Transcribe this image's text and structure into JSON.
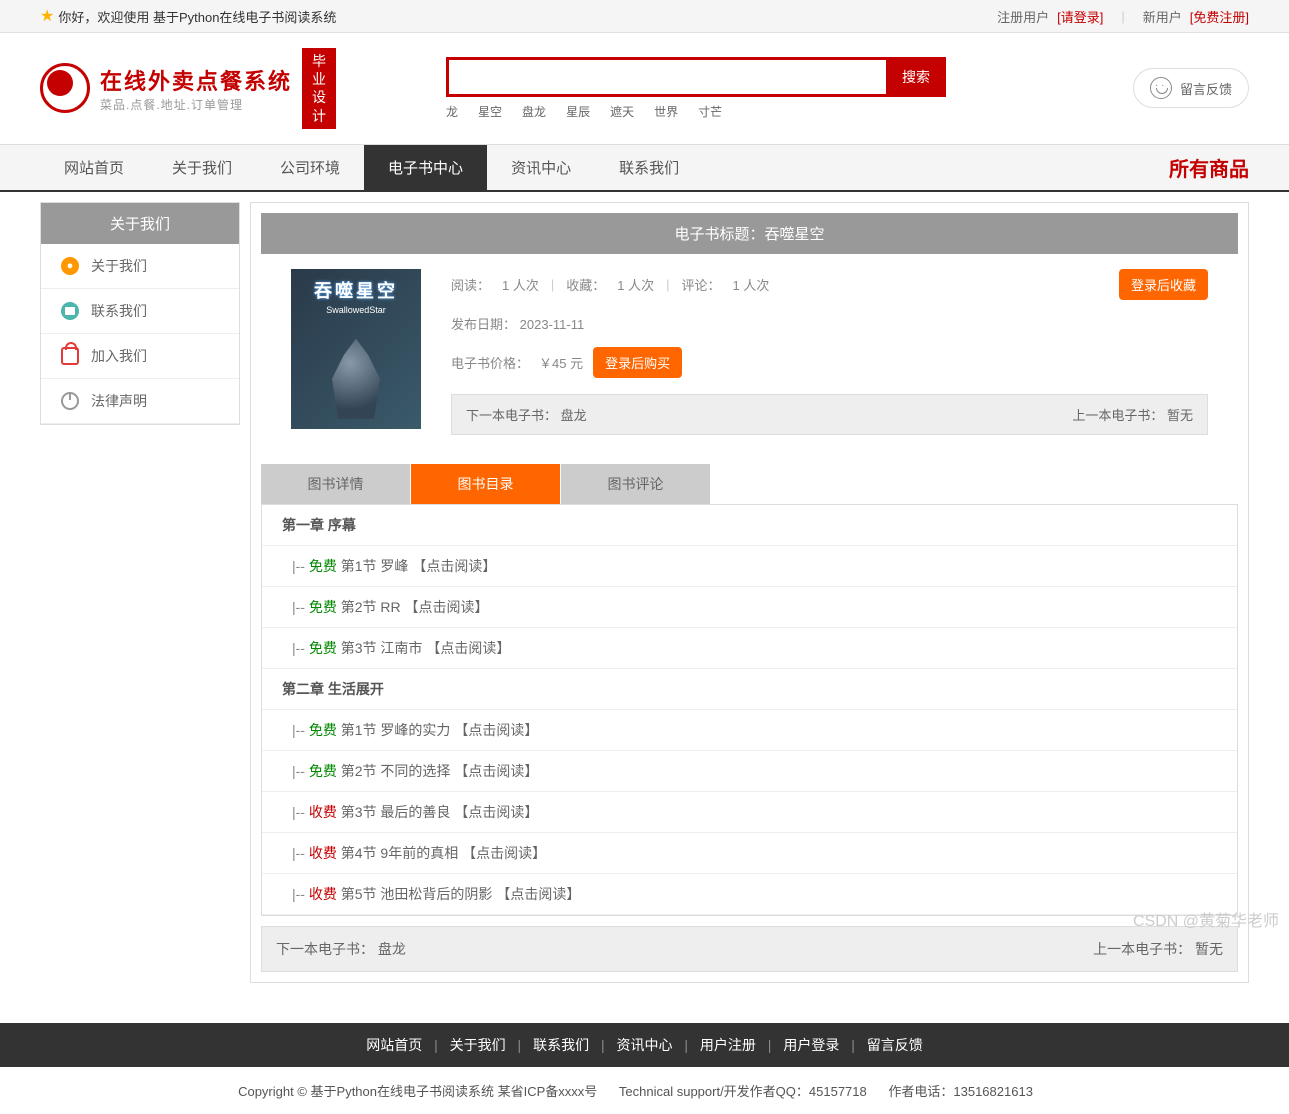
{
  "topbar": {
    "greeting": "你好，欢迎使用 基于Python在线电子书阅读系统",
    "reg_user_label": "注册用户",
    "login_link": "[请登录]",
    "new_user_label": "新用户",
    "register_link": "[免费注册]"
  },
  "header": {
    "logo_title": "在线外卖点餐系统",
    "logo_sub": "菜品.点餐.地址.订单管理",
    "logo_badge_1": "毕业",
    "logo_badge_2": "设计",
    "search_placeholder": "",
    "search_button": "搜索",
    "hot_words": [
      "龙",
      "星空",
      "盘龙",
      "星辰",
      "遮天",
      "世界",
      "寸芒"
    ],
    "feedback": "留言反馈"
  },
  "nav": {
    "items": [
      "网站首页",
      "关于我们",
      "公司环境",
      "电子书中心",
      "资讯中心",
      "联系我们"
    ],
    "active_index": 3,
    "all_products": "所有商品"
  },
  "sidebar": {
    "title": "关于我们",
    "items": [
      "关于我们",
      "联系我们",
      "加入我们",
      "法律声明"
    ]
  },
  "book": {
    "title_bar": "电子书标题：吞噬星空",
    "cover_cn": "吞噬星空",
    "cover_en": "SwallowedStar",
    "read_label": "阅读：",
    "read_value": "1 人次",
    "fav_label": "收藏：",
    "fav_value": "1 人次",
    "comment_label": "评论：",
    "comment_value": "1 人次",
    "collect_btn": "登录后收藏",
    "pub_label": "发布日期：",
    "pub_value": "2023-11-11",
    "price_label": "电子书价格：",
    "price_value": "￥45 元",
    "buy_btn": "登录后购买",
    "next_label": "下一本电子书：",
    "next_value": "盘龙",
    "prev_label": "上一本电子书：",
    "prev_value": "暂无"
  },
  "tabs": {
    "items": [
      "图书详情",
      "图书目录",
      "图书评论"
    ],
    "active_index": 1
  },
  "chapters": [
    {
      "type": "chapter",
      "text": "第一章 序幕"
    },
    {
      "type": "section",
      "tag": "free",
      "text": "第1节 罗峰 【点击阅读】"
    },
    {
      "type": "section",
      "tag": "free",
      "text": "第2节 RR 【点击阅读】"
    },
    {
      "type": "section",
      "tag": "free",
      "text": "第3节 江南市 【点击阅读】"
    },
    {
      "type": "chapter",
      "text": "第二章 生活展开"
    },
    {
      "type": "section",
      "tag": "free",
      "text": "第1节 罗峰的实力 【点击阅读】"
    },
    {
      "type": "section",
      "tag": "free",
      "text": "第2节 不同的选择 【点击阅读】"
    },
    {
      "type": "section",
      "tag": "paid",
      "text": "第3节 最后的善良 【点击阅读】"
    },
    {
      "type": "section",
      "tag": "paid",
      "text": "第4节 9年前的真相 【点击阅读】"
    },
    {
      "type": "section",
      "tag": "paid",
      "text": "第5节 池田松背后的阴影 【点击阅读】"
    }
  ],
  "tags": {
    "free": "免费",
    "paid": "收费"
  },
  "footer": {
    "nav": [
      "网站首页",
      "关于我们",
      "联系我们",
      "资讯中心",
      "用户注册",
      "用户登录",
      "留言反馈"
    ],
    "copyright": "Copyright © 基于Python在线电子书阅读系统 某省ICP备xxxx号",
    "tech": "Technical support/开发作者QQ：45157718",
    "phone": "作者电话：13516821613"
  },
  "watermark": "CSDN @黄菊华老师"
}
